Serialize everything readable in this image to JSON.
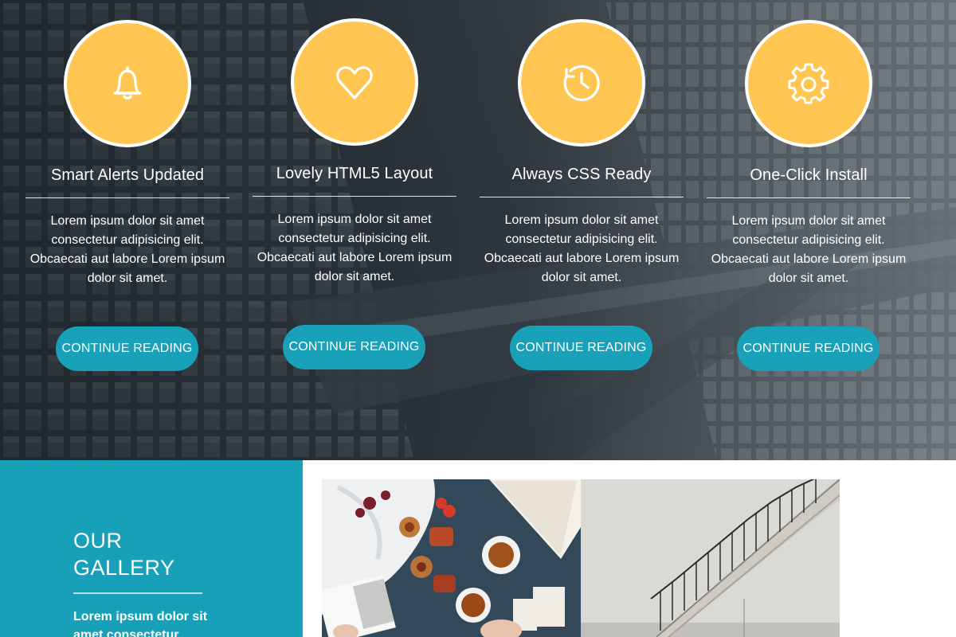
{
  "features": [
    {
      "icon": "bell-icon",
      "title": "Smart Alerts Updated",
      "text": "Lorem ipsum dolor sit amet consectetur adipisicing elit. Obcaecati aut labore Lorem ipsum dolor sit amet.",
      "button": "CONTINUE READING"
    },
    {
      "icon": "heart-icon",
      "title": "Lovely HTML5 Layout",
      "text": "Lorem ipsum dolor sit amet consectetur adipisicing elit. Obcaecati aut labore Lorem ipsum dolor sit amet.",
      "button": "CONTINUE READING"
    },
    {
      "icon": "clock-icon",
      "title": "Always CSS Ready",
      "text": "Lorem ipsum dolor sit amet consectetur adipisicing elit. Obcaecati aut labore Lorem ipsum dolor sit amet.",
      "button": "CONTINUE READING"
    },
    {
      "icon": "gear-icon",
      "title": "One-Click Install",
      "text": "Lorem ipsum dolor sit amet consectetur adipisicing elit. Obcaecati aut labore Lorem ipsum dolor sit amet.",
      "button": "CONTINUE READING"
    }
  ],
  "gallery": {
    "title_line1": "OUR",
    "title_line2": "GALLERY",
    "text": "Lorem ipsum dolor sit amet consectetur"
  },
  "colors": {
    "accent_teal": "#18a1b9",
    "icon_circle_yellow": "#ffc652",
    "gallery_panel": "#17a0b7"
  }
}
